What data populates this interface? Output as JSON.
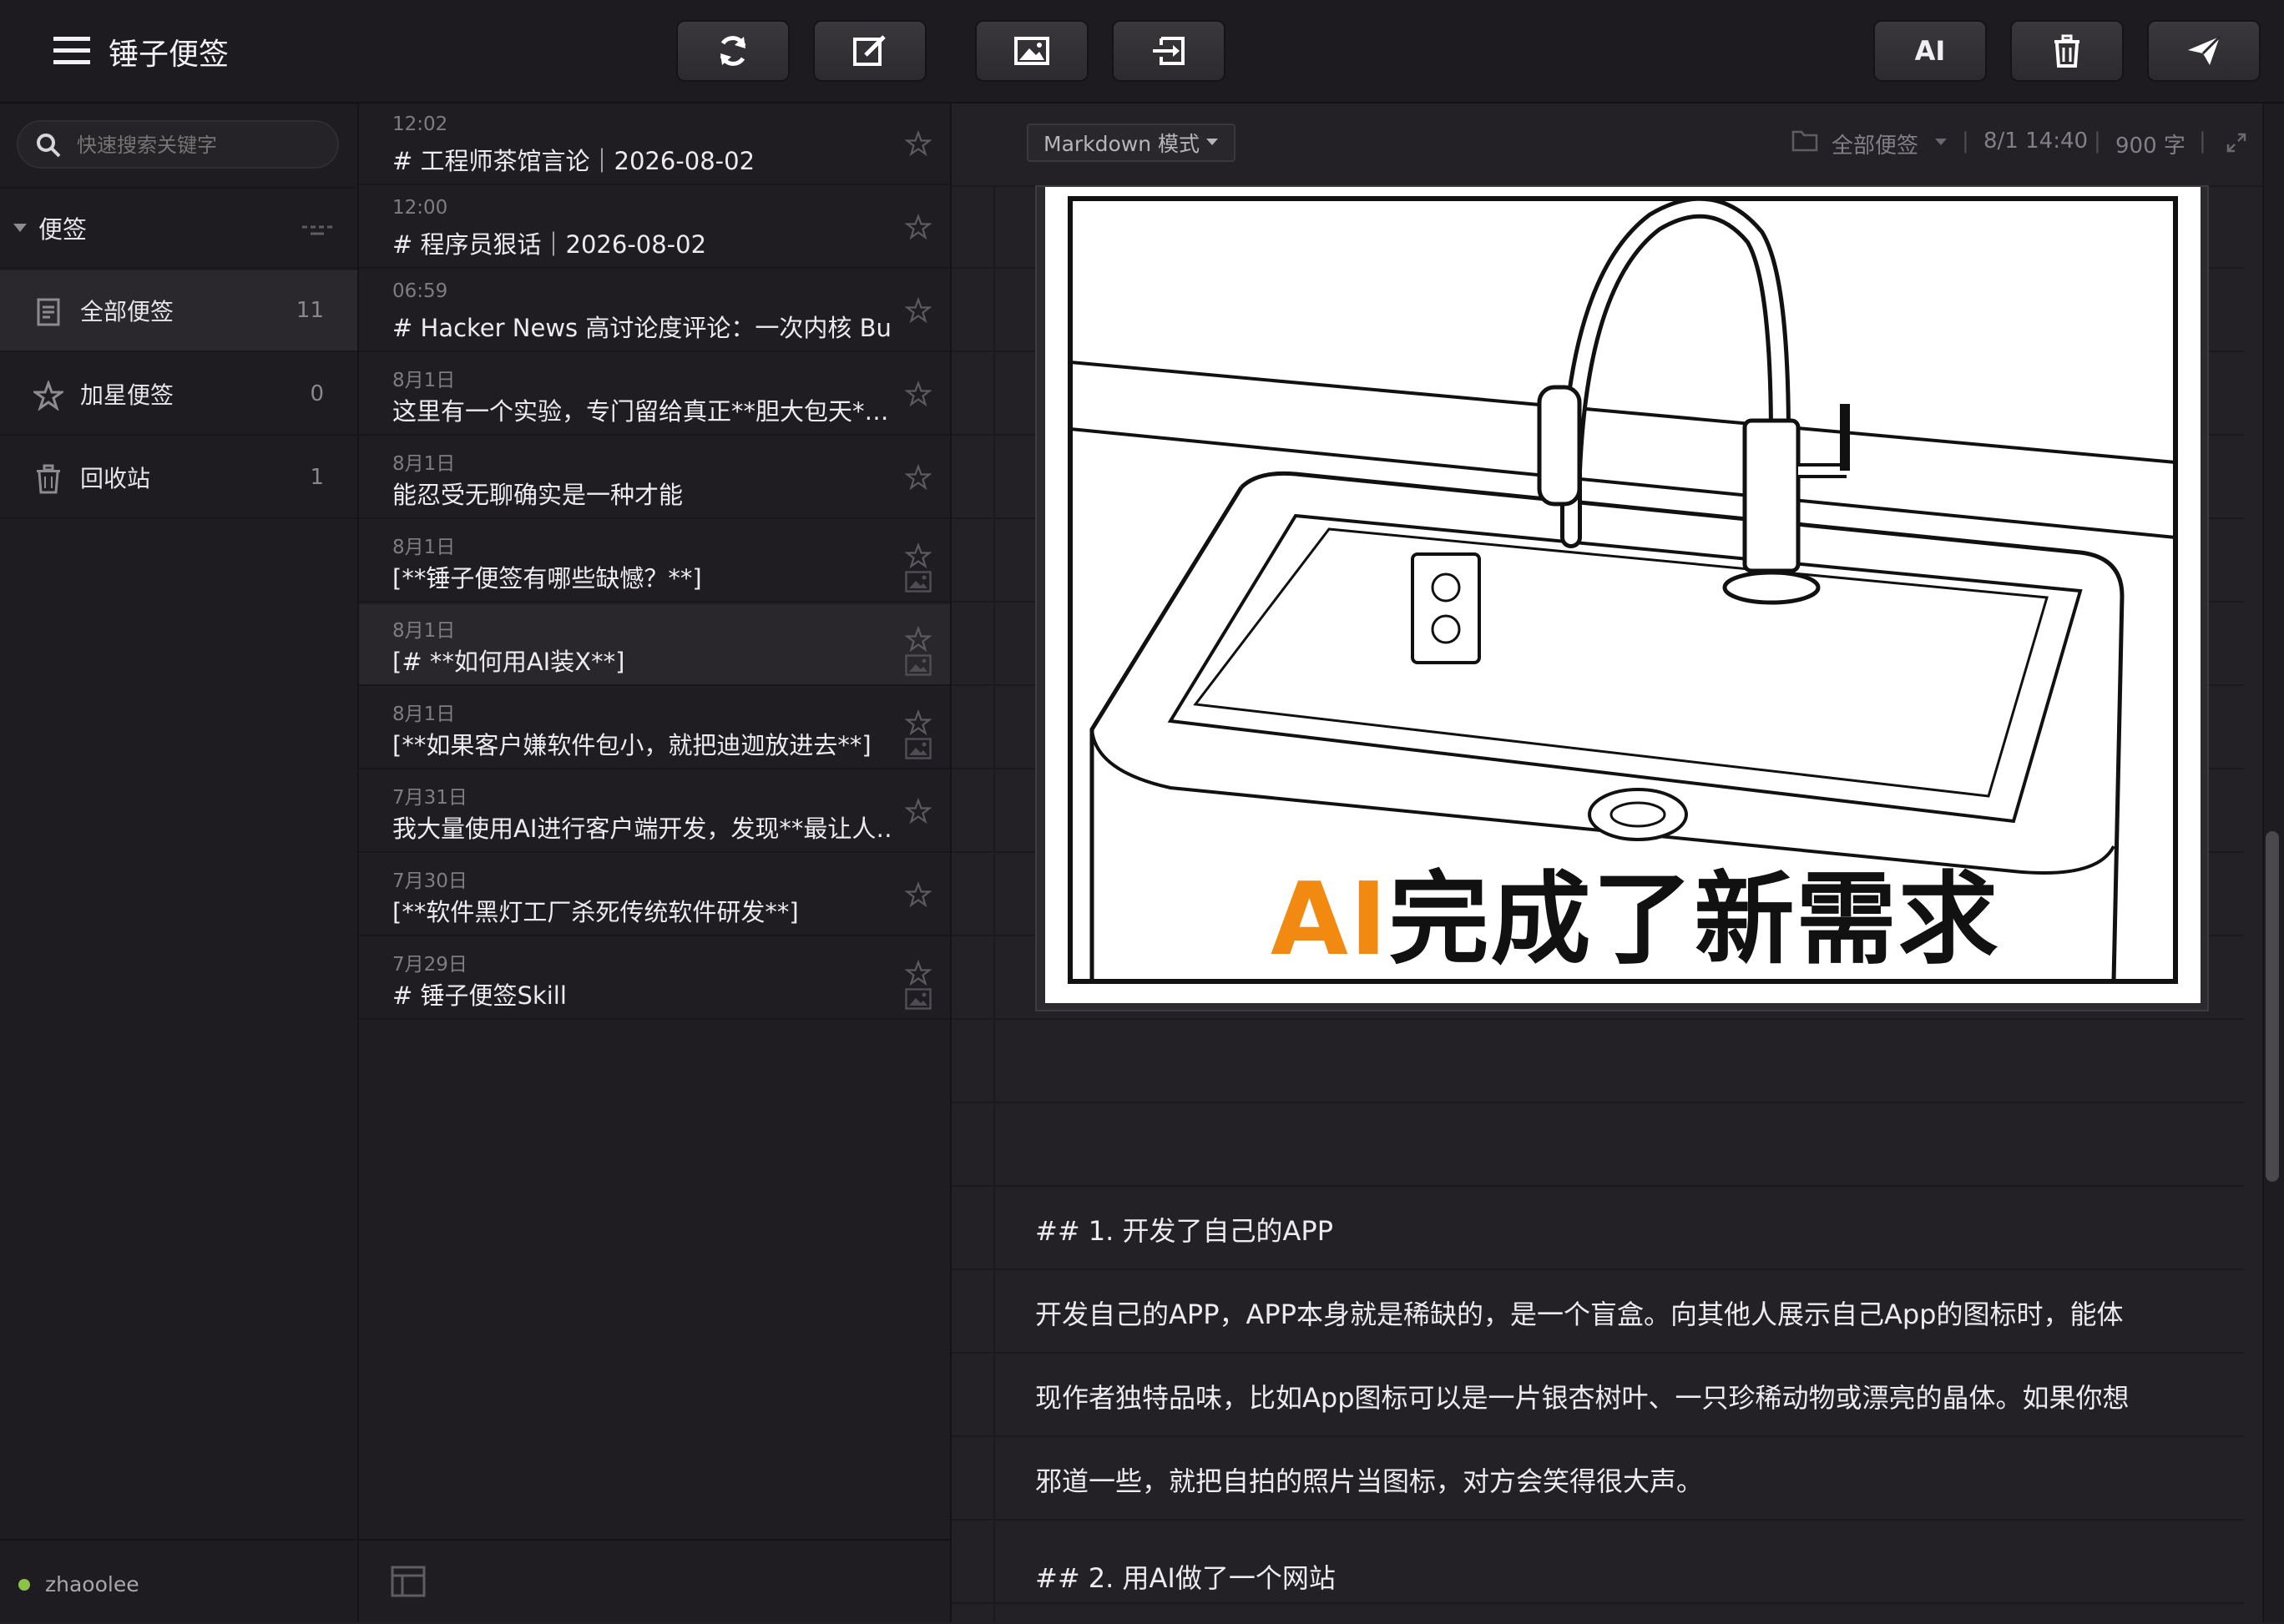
{
  "app": {
    "title": "锤子便签"
  },
  "toolbar": {
    "sync": "sync-icon",
    "new_note": "edit-icon",
    "insert_image": "image-icon",
    "import": "import-icon",
    "ai_label": "AI",
    "delete": "trash-icon",
    "send": "send-icon"
  },
  "search": {
    "placeholder": "快速搜索关键字"
  },
  "sidebar": {
    "section_label": "便签",
    "items": [
      {
        "label": "全部便签",
        "count": "11",
        "icon": "notes-icon"
      },
      {
        "label": "加星便签",
        "count": "0",
        "icon": "star-icon"
      },
      {
        "label": "回收站",
        "count": "1",
        "icon": "trash-icon"
      }
    ],
    "user": "zhaoolee"
  },
  "notes": [
    {
      "date": "12:02",
      "title": "# 工程师茶馆言论｜2026-08-02",
      "has_image": false
    },
    {
      "date": "12:00",
      "title": "# 程序员狠话｜2026-08-02",
      "has_image": false
    },
    {
      "date": "06:59",
      "title": "# Hacker News 高讨论度评论：一次内核 Bu…",
      "has_image": false
    },
    {
      "date": "8月1日",
      "title": "这里有一个实验，专门留给真正**胆大包天*…",
      "has_image": false
    },
    {
      "date": "8月1日",
      "title": "能忍受无聊确实是一种才能",
      "has_image": false
    },
    {
      "date": "8月1日",
      "title": "[**锤子便签有哪些缺憾？**]",
      "has_image": true
    },
    {
      "date": "8月1日",
      "title": "[# **如何用AI装X**]",
      "has_image": true
    },
    {
      "date": "8月1日",
      "title": "[**如果客户嫌软件包小，就把迪迦放进去**]",
      "has_image": true
    },
    {
      "date": "7月31日",
      "title": "我大量使用AI进行客户端开发，发现**最让人…",
      "has_image": false
    },
    {
      "date": "7月30日",
      "title": "[**软件黑灯工厂杀死传统软件研发**]",
      "has_image": false
    },
    {
      "date": "7月29日",
      "title": "# 锤子便签Skill",
      "has_image": true
    }
  ],
  "editor": {
    "mode": "Markdown 模式",
    "folder": "全部便签",
    "timestamp": "8/1 14:40",
    "word_count": "900 字",
    "image_caption_highlight": "AI",
    "image_caption_rest": "完成了新需求",
    "lines": [
      "## 1. 开发了自己的APP",
      "开发自己的APP，APP本身就是稀缺的，是一个盲盒。向其他人展示自己App的图标时，能体",
      "现作者独特品味，比如App图标可以是一片银杏树叶、一只珍稀动物或漂亮的晶体。如果你想",
      "邪道一些，就把自拍的照片当图标，对方会笑得很大声。",
      "",
      "## 2. 用AI做了一个网站"
    ]
  },
  "colors": {
    "caption_highlight": "#f28a11",
    "online_dot": "#8bc34a"
  }
}
